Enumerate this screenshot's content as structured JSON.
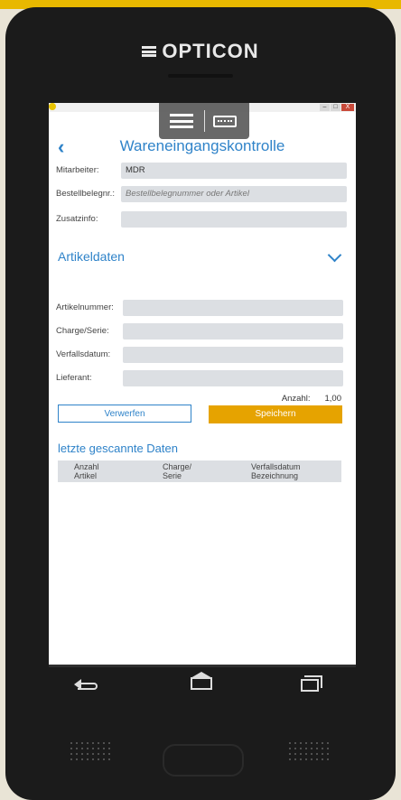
{
  "device": {
    "brand": "OPTICON"
  },
  "app": {
    "title": "Wareneingangskontrolle",
    "back_icon": "chevron-left-icon",
    "window_buttons": [
      "–",
      "□",
      "X"
    ]
  },
  "header_fields": [
    {
      "label": "Mitarbeiter:",
      "value": "MDR",
      "placeholder": ""
    },
    {
      "label": "Bestellbelegnr.:",
      "value": "",
      "placeholder": "Bestellbelegnummer oder Artikel"
    },
    {
      "label": "Zusatzinfo:",
      "value": "",
      "placeholder": ""
    }
  ],
  "artikeldaten": {
    "title": "Artikeldaten",
    "fields": [
      {
        "label": "Artikelnummer:",
        "value": ""
      },
      {
        "label": "Charge/Serie:",
        "value": ""
      },
      {
        "label": "Verfallsdatum:",
        "value": ""
      },
      {
        "label": "Lieferant:",
        "value": ""
      }
    ],
    "anzahl_label": "Anzahl:",
    "anzahl_value": "1,00"
  },
  "buttons": {
    "discard": "Verwerfen",
    "save": "Speichern"
  },
  "recent": {
    "title": "letzte gescannte Daten",
    "columns": [
      {
        "line1": "Anzahl",
        "line2": "Artikel"
      },
      {
        "line1": "Charge/",
        "line2": "Serie"
      },
      {
        "line1": "Verfallsdatum",
        "line2": "Bezeichnung"
      }
    ]
  },
  "colors": {
    "accent": "#2f83c9",
    "save": "#e6a300",
    "field": "#dcdfe3"
  }
}
